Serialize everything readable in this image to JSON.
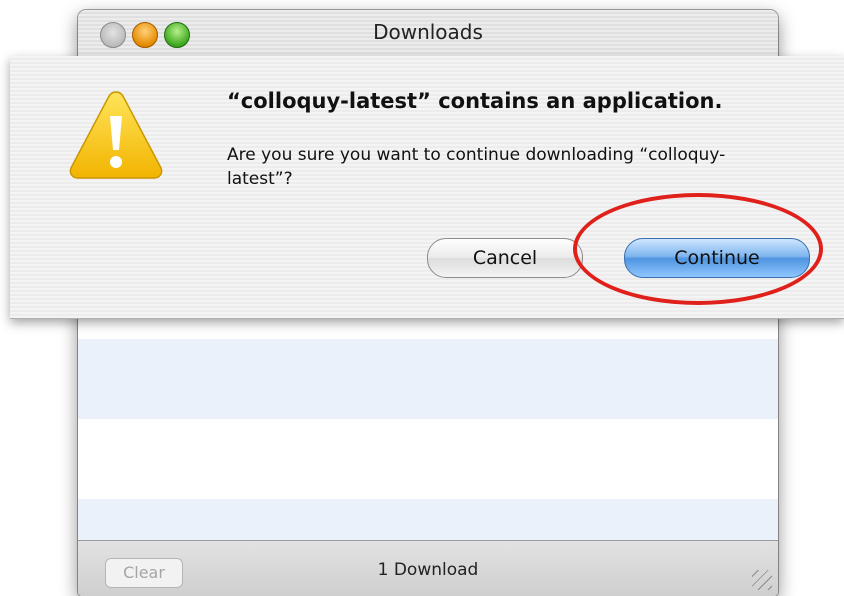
{
  "window": {
    "title": "Downloads",
    "status": "1 Download",
    "clear_label": "Clear",
    "ghost_item_name": "colloquy-latest"
  },
  "sheet": {
    "title": "“colloquy-latest” contains an application.",
    "message": "Are you sure you want to continue downloading “colloquy-latest”?",
    "cancel_label": "Cancel",
    "continue_label": "Continue"
  },
  "icons": {
    "warning": "warning-triangle-icon",
    "close": "close-button",
    "minimize": "minimize-button",
    "zoom": "zoom-button"
  },
  "colors": {
    "accent": "#4f95e0",
    "highlight": "#e0201a",
    "warning": "#f8c400"
  }
}
